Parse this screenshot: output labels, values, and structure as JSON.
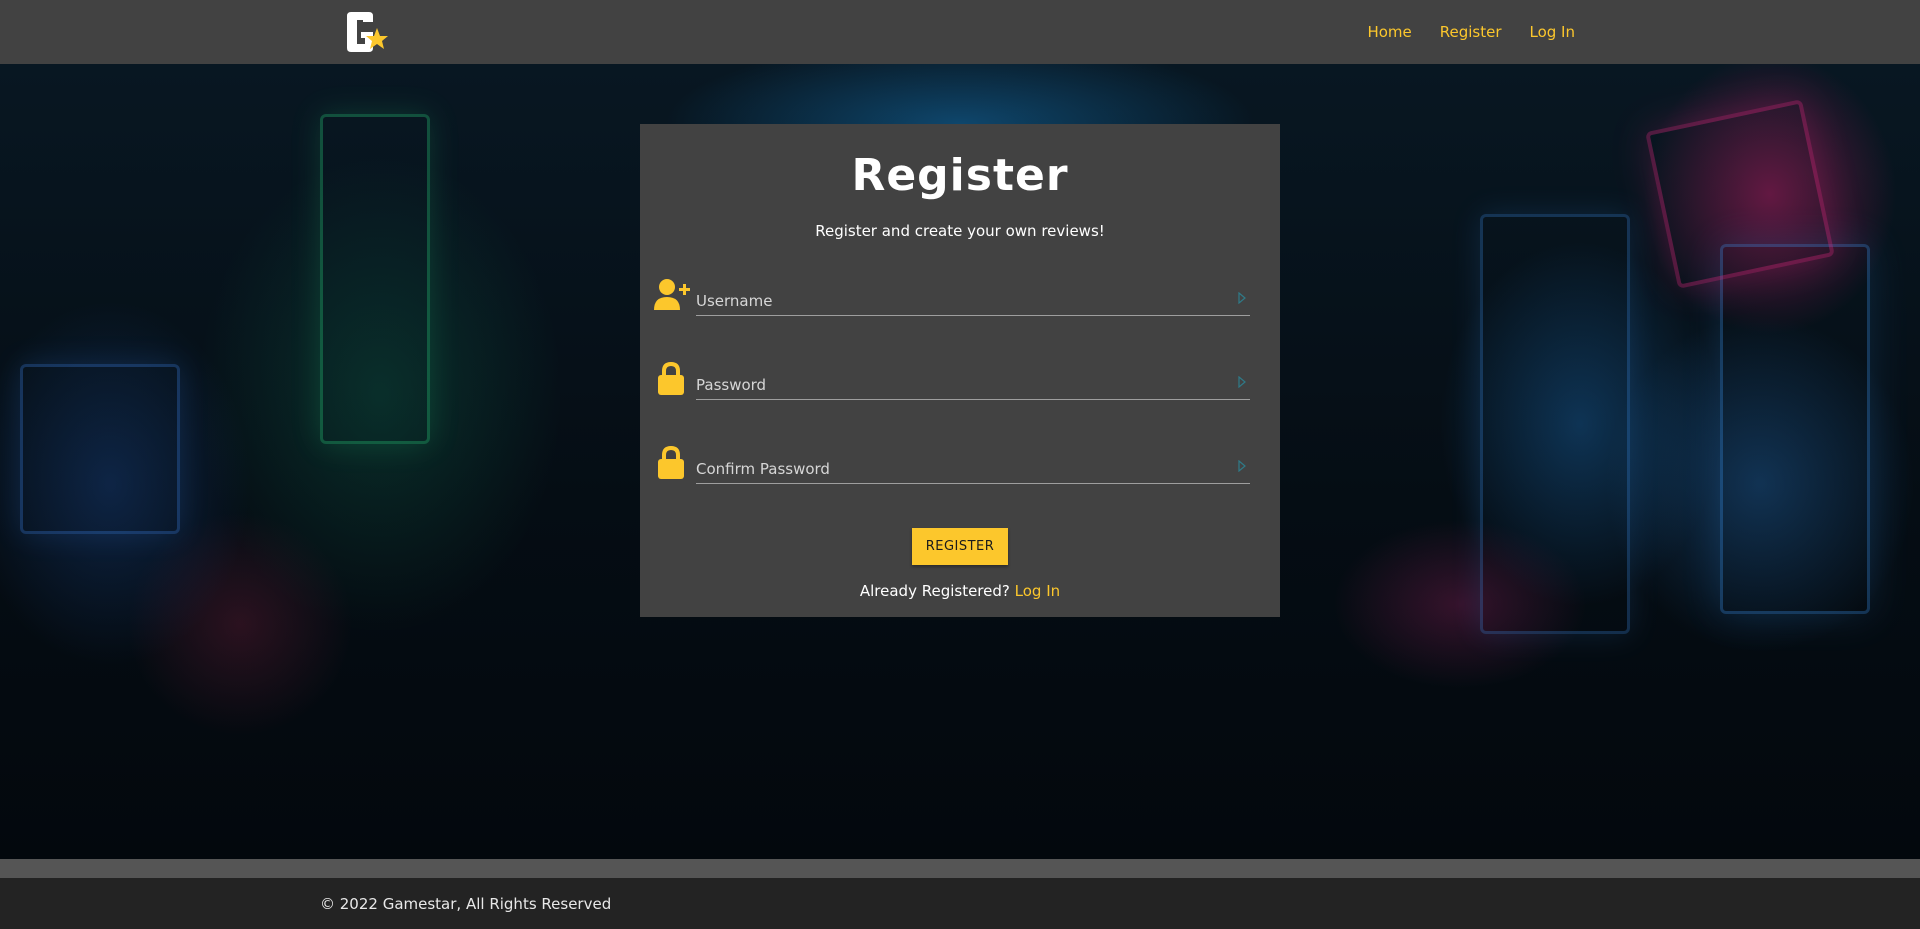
{
  "nav": {
    "links": [
      "Home",
      "Register",
      "Log In"
    ]
  },
  "card": {
    "title": "Register",
    "subtitle": "Register and create your own reviews!",
    "fields": [
      {
        "placeholder": "Username",
        "icon": "user-plus-icon"
      },
      {
        "placeholder": "Password",
        "icon": "lock-icon"
      },
      {
        "placeholder": "Confirm Password",
        "icon": "lock-icon"
      }
    ],
    "submit_label": "REGISTER",
    "already_text": "Already Registered?",
    "login_link": "Log In"
  },
  "footer": {
    "text": "© 2022 Gamestar, All Rights Reserved"
  },
  "colors": {
    "accent": "#fcc72c",
    "navbar": "#424242",
    "card": "#424242",
    "footer": "#232323"
  }
}
